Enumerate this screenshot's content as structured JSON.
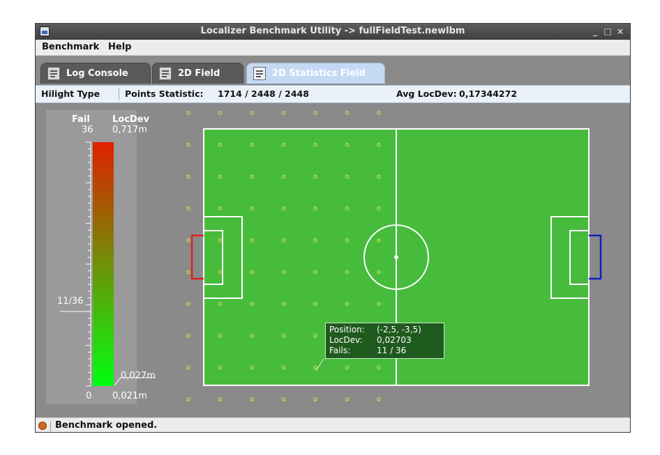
{
  "window": {
    "title": "Localizer Benchmark Utility -> fullFieldTest.newlbm",
    "controls": [
      "_",
      "□",
      "×"
    ]
  },
  "menu": {
    "items": [
      "Benchmark",
      "Help"
    ]
  },
  "tabs": [
    {
      "label": "Log Console",
      "active": false
    },
    {
      "label": "2D Field",
      "active": false
    },
    {
      "label": "2D Statistics Field",
      "active": true
    }
  ],
  "infobar": {
    "hilight_type": "Hilight Type",
    "points_label": "Points Statistic:",
    "points_value": "1714 / 2448 / 2448",
    "avg_label": "Avg LocDev:",
    "avg_value": "0,17344272"
  },
  "legend": {
    "fail_header": "Fail",
    "locdev_header": "LocDev",
    "fail_max": "36",
    "fail_min": "0",
    "locdev_max": "0,717m",
    "locdev_min": "0,021m",
    "fail_marker": "11/36",
    "locdev_marker": "0,027m",
    "fail_fraction": 0.3056,
    "gradient": [
      "#e02000",
      "#00ff10"
    ]
  },
  "tooltip": {
    "position_label": "Position:",
    "position_value": "(-2,5, -3,5)",
    "locdev_label": "LocDev:",
    "locdev_value": "0,02703",
    "fails_label": "Fails:",
    "fails_value": "11 / 36"
  },
  "colors": {
    "field": "#46bb3c",
    "own_goal": "#e02020",
    "opp_goal": "#1020c0",
    "grid_point": "#c8e050"
  },
  "status": {
    "message": "Benchmark opened."
  }
}
